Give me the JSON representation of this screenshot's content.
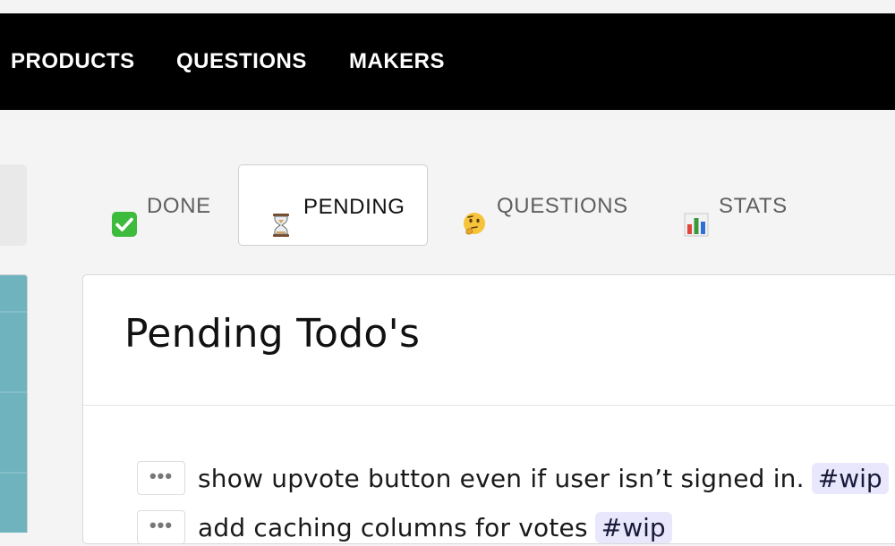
{
  "navbar": {
    "items": [
      {
        "label": "PRODUCTS"
      },
      {
        "label": "QUESTIONS"
      },
      {
        "label": "MAKERS"
      }
    ]
  },
  "tabs": [
    {
      "label": "DONE",
      "icon": "check-mark-icon",
      "active": false
    },
    {
      "label": "PENDING",
      "icon": "hourglass-icon",
      "active": true
    },
    {
      "label": "QUESTIONS",
      "icon": "thinking-face-icon",
      "active": false
    },
    {
      "label": "STATS",
      "icon": "bar-chart-icon",
      "active": false
    }
  ],
  "panel": {
    "title": "Pending Todo's",
    "todos": [
      {
        "menu": "•••",
        "text": "show upvote button even if user isn’t signed in.",
        "tag": "#wip"
      },
      {
        "menu": "•••",
        "text": "add caching columns for votes",
        "tag": "#wip"
      }
    ]
  },
  "colors": {
    "navbar_bg": "#000000",
    "page_bg": "#f4f4f4",
    "tag_bg": "#e9e7fb",
    "check_green": "#3dbb3d"
  }
}
